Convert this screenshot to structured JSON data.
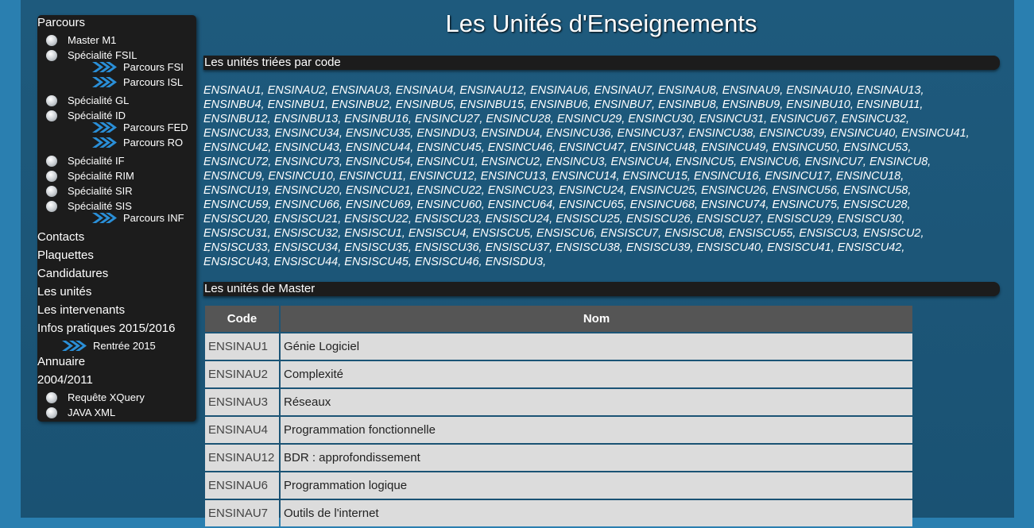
{
  "sidebar": {
    "parcours": "Parcours",
    "master_m1": "Master M1",
    "spec_fsil": "Spécialité FSIL",
    "parcours_fsi": "Parcours FSI",
    "parcours_isl": "Parcours ISL",
    "spec_gl": "Spécialité GL",
    "spec_id": "Spécialité ID",
    "parcours_fed": "Parcours FED",
    "parcours_ro": "Parcours RO",
    "spec_if": "Spécialité IF",
    "spec_rim": "Spécialité RIM",
    "spec_sir": "Spécialité SIR",
    "spec_sis": "Spécialité SIS",
    "parcours_inf": "Parcours INF",
    "contacts": "Contacts",
    "plaquettes": "Plaquettes",
    "candidatures": "Candidatures",
    "les_unites": "Les unités",
    "les_intervenants": "Les intervenants",
    "infos_pratiques": "Infos pratiques 2015/2016",
    "rentree": "Rentrée 2015",
    "annuaire": "Annuaire",
    "y2004": "2004/2011",
    "requete_xquery": "Requête XQuery",
    "java_xml": "JAVA XML"
  },
  "main": {
    "title": "Les Unités d'Enseignements",
    "section_codes": "Les unités triées par code",
    "codes_lines": [
      "ENSINAU1, ENSINAU2, ENSINAU3, ENSINAU4, ENSINAU12, ENSINAU6, ENSINAU7, ENSINAU8, ENSINAU9, ENSINAU10, ENSINAU13,",
      "ENSINBU4, ENSINBU1, ENSINBU2, ENSINBU5, ENSINBU15, ENSINBU6, ENSINBU7, ENSINBU8, ENSINBU9, ENSINBU10, ENSINBU11,",
      "ENSINBU12, ENSINBU13, ENSINBU16, ENSINCU27, ENSINCU28, ENSINCU29, ENSINCU30, ENSINCU31, ENSINCU67, ENSINCU32,",
      "ENSINCU33, ENSINCU34, ENSINCU35, ENSINDU3, ENSINDU4, ENSINCU36, ENSINCU37, ENSINCU38, ENSINCU39, ENSINCU40, ENSINCU41,",
      "ENSINCU42, ENSINCU43, ENSINCU44, ENSINCU45, ENSINCU46, ENSINCU47, ENSINCU48, ENSINCU49, ENSINCU50, ENSINCU53,",
      "ENSINCU72, ENSINCU73, ENSINCU54, ENSINCU1, ENSINCU2, ENSINCU3, ENSINCU4, ENSINCU5, ENSINCU6, ENSINCU7, ENSINCU8,",
      "ENSINCU9, ENSINCU10, ENSINCU11, ENSINCU12, ENSINCU13, ENSINCU14, ENSINCU15, ENSINCU16, ENSINCU17, ENSINCU18,",
      "ENSINCU19, ENSINCU20, ENSINCU21, ENSINCU22, ENSINCU23, ENSINCU24, ENSINCU25, ENSINCU26, ENSINCU56, ENSINCU58,",
      "ENSINCU59, ENSINCU66, ENSINCU69, ENSINCU60, ENSINCU64, ENSINCU65, ENSINCU68, ENSINCU74, ENSINCU75, ENSISCU28,",
      "ENSISCU20, ENSISCU21, ENSISCU22, ENSISCU23, ENSISCU24, ENSISCU25, ENSISCU26, ENSISCU27, ENSISCU29, ENSISCU30,",
      "ENSISCU31, ENSISCU32, ENSISCU1, ENSISCU4, ENSISCU5, ENSISCU6, ENSISCU7, ENSISCU8, ENSISCU55, ENSISCU3, ENSISCU2,",
      "ENSISCU33, ENSISCU34, ENSISCU35, ENSISCU36, ENSISCU37, ENSISCU38, ENSISCU39, ENSISCU40, ENSISCU41, ENSISCU42,",
      "ENSISCU43, ENSISCU44, ENSISCU45, ENSISCU46, ENSISDU3,"
    ],
    "section_master": "Les unités de Master",
    "table": {
      "header_code": "Code",
      "header_nom": "Nom",
      "rows": [
        {
          "code": "ENSINAU1",
          "nom": "Génie Logiciel"
        },
        {
          "code": "ENSINAU2",
          "nom": "Complexité"
        },
        {
          "code": "ENSINAU3",
          "nom": "Réseaux"
        },
        {
          "code": "ENSINAU4",
          "nom": "Programmation fonctionnelle"
        },
        {
          "code": "ENSINAU12",
          "nom": "BDR : approfondissement"
        },
        {
          "code": "ENSINAU6",
          "nom": "Programmation logique"
        },
        {
          "code": "ENSINAU7",
          "nom": "Outils de l'internet"
        }
      ]
    }
  },
  "colors": {
    "body_bg": "#2a7fb0",
    "page_bg": "#1e5a7d",
    "panel_bg": "#1c1c1c",
    "table_header_bg": "#555555",
    "table_cell_bg": "#dcdcdc",
    "chevron": "#2a8fd8"
  }
}
